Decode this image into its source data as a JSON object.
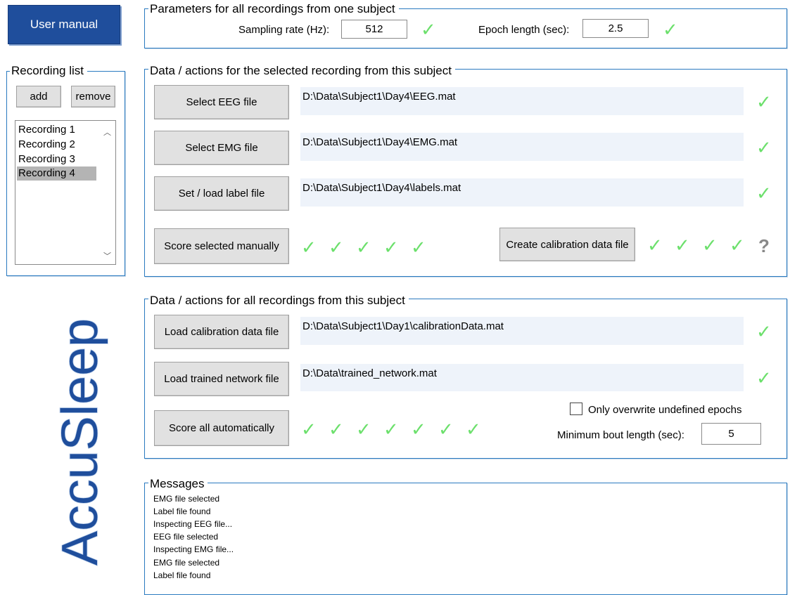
{
  "app": {
    "logo_text": "AccuSleep",
    "user_manual_label": "User manual",
    "colors": {
      "accent": "#2a7ac0",
      "primary_button": "#1f4e9c",
      "check": "#6ce06c",
      "logo": "#1f4e9c"
    }
  },
  "params": {
    "title": "Parameters for all recordings from one subject",
    "sampling_label": "Sampling rate (Hz):",
    "sampling_value": "512",
    "epoch_label": "Epoch length (sec):",
    "epoch_value": "2.5",
    "check": "✓"
  },
  "recording_list": {
    "title": "Recording list",
    "add_label": "add",
    "remove_label": "remove",
    "items": [
      "Recording 1",
      "Recording 2",
      "Recording 3",
      "Recording 4"
    ],
    "selected_index": 3
  },
  "selected": {
    "title": "Data / actions for the selected recording from this subject",
    "eeg_button": "Select EEG file",
    "eeg_path": "D:\\Data\\Subject1\\Day4\\EEG.mat",
    "emg_button": "Select EMG file",
    "emg_path": "D:\\Data\\Subject1\\Day4\\EMG.mat",
    "label_button": "Set / load label file",
    "label_path": "D:\\Data\\Subject1\\Day4\\labels.mat",
    "score_button": "Score selected manually",
    "calib_button": "Create calibration data file",
    "check": "✓",
    "unknown": "?"
  },
  "all": {
    "title": "Data / actions for all recordings from this subject",
    "calib_button": "Load calibration data file",
    "calib_path": "D:\\Data\\Subject1\\Day1\\calibrationData.mat",
    "network_button": "Load trained network file",
    "network_path": "D:\\Data\\trained_network.mat",
    "score_button": "Score all automatically",
    "overwrite_label": "Only overwrite undefined epochs",
    "overwrite_checked": false,
    "bout_label": "Minimum bout length (sec):",
    "bout_value": "5",
    "check": "✓"
  },
  "messages": {
    "title": "Messages",
    "lines": [
      "EMG file selected",
      "Label file found",
      "Inspecting EEG file...",
      "EEG file selected",
      "Inspecting EMG file...",
      "EMG file selected",
      "Label file found"
    ]
  }
}
